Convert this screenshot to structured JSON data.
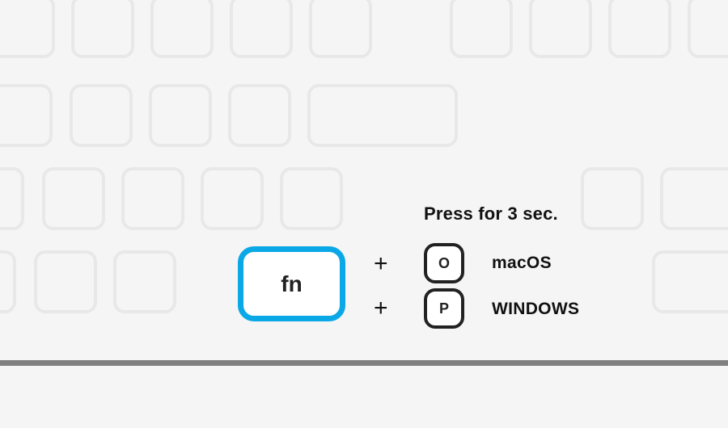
{
  "instruction": "Press for 3 sec.",
  "main_key": {
    "label": "fn"
  },
  "plus_symbol": "+",
  "combos": [
    {
      "key": "O",
      "os": "macOS"
    },
    {
      "key": "P",
      "os": "WINDOWS"
    }
  ]
}
